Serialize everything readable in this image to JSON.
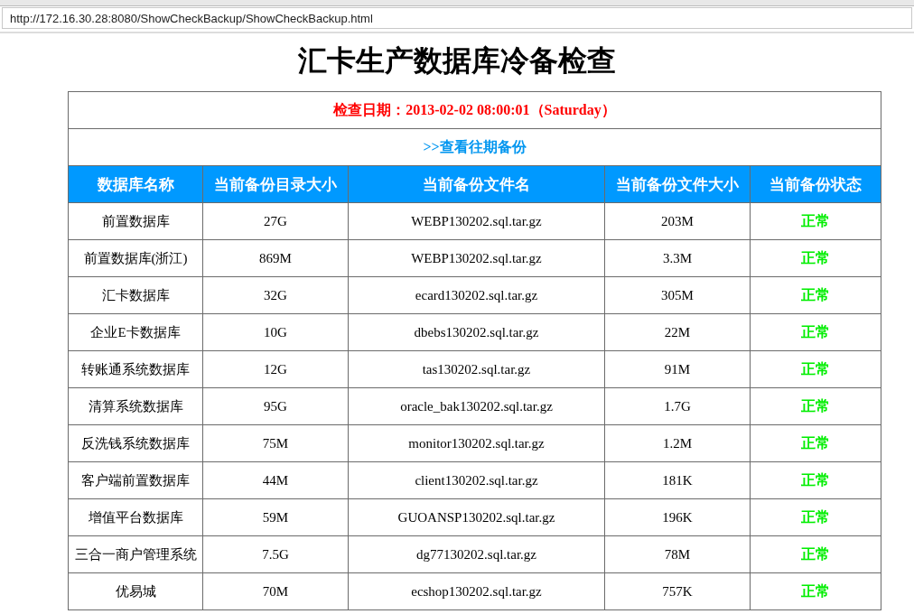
{
  "address_bar": {
    "url": "http://172.16.30.28:8080/ShowCheckBackup/ShowCheckBackup.html"
  },
  "page_title": "汇卡生产数据库冷备检查",
  "check_date": "检查日期：2013-02-02 08:00:01（Saturday）",
  "history_link": ">>查看往期备份",
  "table": {
    "columns": [
      "数据库名称",
      "当前备份目录大小",
      "当前备份文件名",
      "当前备份文件大小",
      "当前备份状态"
    ],
    "rows": [
      {
        "name": "前置数据库",
        "dir_size": "27G",
        "file": "WEBP130202.sql.tar.gz",
        "file_size": "203M",
        "status": "正常",
        "ok": true
      },
      {
        "name": "前置数据库(浙江)",
        "dir_size": "869M",
        "file": "WEBP130202.sql.tar.gz",
        "file_size": "3.3M",
        "status": "正常",
        "ok": true
      },
      {
        "name": "汇卡数据库",
        "dir_size": "32G",
        "file": "ecard130202.sql.tar.gz",
        "file_size": "305M",
        "status": "正常",
        "ok": true
      },
      {
        "name": "企业E卡数据库",
        "dir_size": "10G",
        "file": "dbebs130202.sql.tar.gz",
        "file_size": "22M",
        "status": "正常",
        "ok": true
      },
      {
        "name": "转账通系统数据库",
        "dir_size": "12G",
        "file": "tas130202.sql.tar.gz",
        "file_size": "91M",
        "status": "正常",
        "ok": true
      },
      {
        "name": "清算系统数据库",
        "dir_size": "95G",
        "file": "oracle_bak130202.sql.tar.gz",
        "file_size": "1.7G",
        "status": "正常",
        "ok": true
      },
      {
        "name": "反洗钱系统数据库",
        "dir_size": "75M",
        "file": "monitor130202.sql.tar.gz",
        "file_size": "1.2M",
        "status": "正常",
        "ok": true
      },
      {
        "name": "客户端前置数据库",
        "dir_size": "44M",
        "file": "client130202.sql.tar.gz",
        "file_size": "181K",
        "status": "正常",
        "ok": true
      },
      {
        "name": "增值平台数据库",
        "dir_size": "59M",
        "file": "GUOANSP130202.sql.tar.gz",
        "file_size": "196K",
        "status": "正常",
        "ok": true
      },
      {
        "name": "三合一商户管理系统",
        "dir_size": "7.5G",
        "file": "dg77130202.sql.tar.gz",
        "file_size": "78M",
        "status": "正常",
        "ok": true
      },
      {
        "name": "优易城",
        "dir_size": "70M",
        "file": "ecshop130202.sql.tar.gz",
        "file_size": "757K",
        "status": "正常",
        "ok": true
      }
    ]
  }
}
